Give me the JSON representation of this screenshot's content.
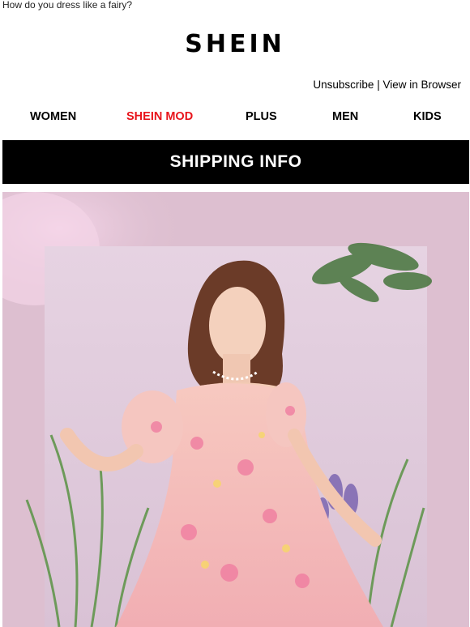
{
  "preheader": "How do you dress like a fairy?",
  "brand": {
    "logo_text": "SHEIN"
  },
  "top_links": {
    "unsubscribe": "Unsubscribe",
    "separator": " | ",
    "view_in_browser": "View in Browser"
  },
  "nav": [
    {
      "label": "WOMEN",
      "color": "#000000"
    },
    {
      "label": "SHEIN MOD",
      "color": "#e8141b"
    },
    {
      "label": "PLUS",
      "color": "#000000"
    },
    {
      "label": "MEN",
      "color": "#000000"
    },
    {
      "label": "KIDS",
      "color": "#000000"
    }
  ],
  "banner": {
    "label": "SHIPPING INFO",
    "background": "#000000",
    "text_color": "#ffffff"
  },
  "hero": {
    "background": "#ddbfd0",
    "description": ""
  }
}
